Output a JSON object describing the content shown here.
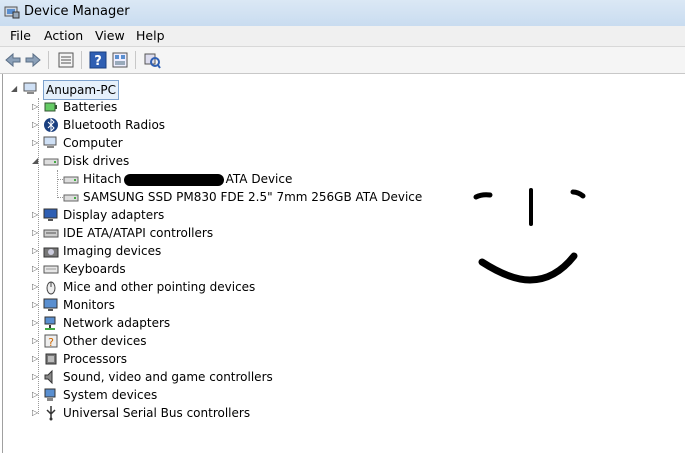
{
  "window": {
    "title": "Device Manager"
  },
  "menu": {
    "file": "File",
    "action": "Action",
    "view": "View",
    "help": "Help"
  },
  "toolbar": {
    "icons": [
      "back-icon",
      "forward-icon",
      "properties-icon",
      "help-icon",
      "details-icon",
      "scan-hardware-icon"
    ]
  },
  "tree": {
    "root": "Anupam-PC",
    "categories": [
      {
        "label": "Batteries",
        "icon": "battery-icon"
      },
      {
        "label": "Bluetooth Radios",
        "icon": "bluetooth-icon"
      },
      {
        "label": "Computer",
        "icon": "computer-icon"
      },
      {
        "label": "Disk drives",
        "icon": "disk-drive-icon",
        "expanded": true,
        "children": [
          {
            "label_prefix": "Hitach",
            "label_suffix": "ATA Device",
            "note": "name partially scribbled out"
          },
          {
            "label": "SAMSUNG SSD PM830 FDE 2.5\" 7mm 256GB ATA Device"
          }
        ]
      },
      {
        "label": "Display adapters",
        "icon": "display-icon"
      },
      {
        "label": "IDE ATA/ATAPI controllers",
        "icon": "ide-icon"
      },
      {
        "label": "Imaging devices",
        "icon": "camera-icon"
      },
      {
        "label": "Keyboards",
        "icon": "keyboard-icon"
      },
      {
        "label": "Mice and other pointing devices",
        "icon": "mouse-icon"
      },
      {
        "label": "Monitors",
        "icon": "monitor-icon"
      },
      {
        "label": "Network adapters",
        "icon": "network-icon"
      },
      {
        "label": "Other devices",
        "icon": "unknown-device-icon"
      },
      {
        "label": "Processors",
        "icon": "processor-icon"
      },
      {
        "label": "Sound, video and game controllers",
        "icon": "speaker-icon"
      },
      {
        "label": "System devices",
        "icon": "system-icon"
      },
      {
        "label": "Universal Serial Bus controllers",
        "icon": "usb-icon"
      }
    ]
  },
  "colors": {
    "titlebar": "#dbe8f5",
    "selection": "#e5f0fb"
  }
}
